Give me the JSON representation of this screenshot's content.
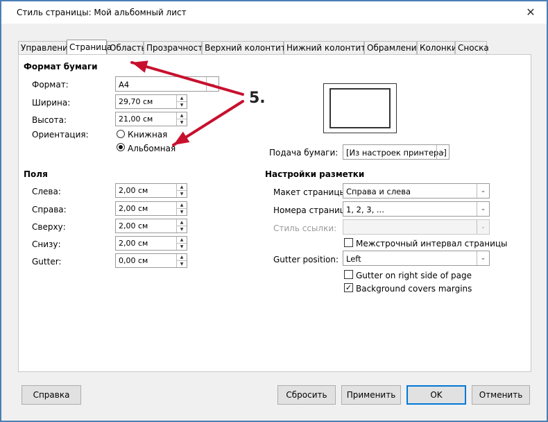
{
  "window": {
    "title": "Стиль страницы: Мой альбомный лист",
    "close_glyph": "✕"
  },
  "tabs": [
    {
      "label": "Управление"
    },
    {
      "label": "Страница"
    },
    {
      "label": "Область"
    },
    {
      "label": "Прозрачность"
    },
    {
      "label": "Верхний колонтитул"
    },
    {
      "label": "Нижний колонтитул"
    },
    {
      "label": "Обрамление"
    },
    {
      "label": "Колонки"
    },
    {
      "label": "Сноска"
    }
  ],
  "active_tab": "Страница",
  "paper_format": {
    "heading": "Формат бумаги",
    "format_label": "Формат:",
    "format_value": "A4",
    "width_label": "Ширина:",
    "width_value": "29,70 см",
    "height_label": "Высота:",
    "height_value": "21,00 см",
    "orientation_label": "Ориентация:",
    "portrait_label": "Книжная",
    "landscape_label": "Альбомная",
    "orientation_selected": "landscape"
  },
  "paper_tray": {
    "label": "Подача бумаги:",
    "value": "[Из настроек принтера]"
  },
  "margins": {
    "heading": "Поля",
    "left_label": "Слева:",
    "left_value": "2,00 см",
    "right_label": "Справа:",
    "right_value": "2,00 см",
    "top_label": "Сверху:",
    "top_value": "2,00 см",
    "bottom_label": "Снизу:",
    "bottom_value": "2,00 см",
    "gutter_label": "Gutter:",
    "gutter_value": "0,00 см"
  },
  "layout": {
    "heading": "Настройки разметки",
    "page_layout_label": "Макет страницы:",
    "page_layout_value": "Справа и слева",
    "page_numbers_label": "Номера страниц:",
    "page_numbers_value": "1, 2, 3, ...",
    "ref_style_label": "Стиль ссылки:",
    "ref_style_value": "",
    "register_true_label": "Межстрочный интервал страницы",
    "register_true_checked": false,
    "gutter_position_label": "Gutter position:",
    "gutter_position_value": "Left",
    "gutter_right_label": "Gutter on right side of page",
    "gutter_right_checked": false,
    "bg_covers_label": "Background covers margins",
    "bg_covers_checked": true
  },
  "buttons": {
    "help": "Справка",
    "reset": "Сбросить",
    "apply": "Применить",
    "ok": "OK",
    "cancel": "Отменить"
  },
  "annotation": {
    "step_label": "5.",
    "arrow_color": "#c8102e"
  },
  "icons": {
    "spin_up": "▲",
    "spin_down": "▼",
    "dropdown": "⌄",
    "check": "✓"
  }
}
